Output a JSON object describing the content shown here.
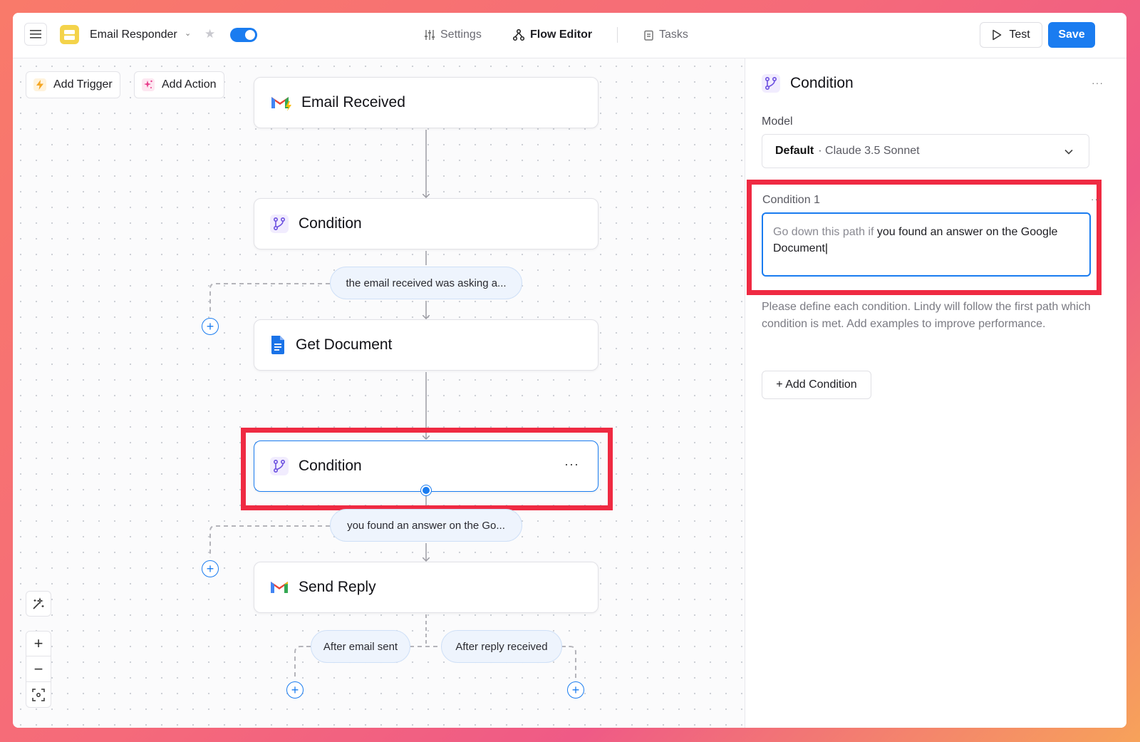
{
  "header": {
    "app_name": "Email Responder",
    "nav": {
      "settings": "Settings",
      "flow_editor": "Flow Editor",
      "tasks": "Tasks"
    },
    "test_label": "Test",
    "save_label": "Save",
    "accent": "#1a7cf0"
  },
  "toolbar": {
    "add_trigger": "Add Trigger",
    "add_action": "Add Action"
  },
  "flow": {
    "nodes": [
      {
        "title": "Email Received",
        "icon": "gmail-icon"
      },
      {
        "title": "Condition",
        "icon": "branch-icon"
      },
      {
        "title": "Get Document",
        "icon": "google-doc-icon"
      },
      {
        "title": "Condition",
        "icon": "branch-icon",
        "more": "···"
      },
      {
        "title": "Send Reply",
        "icon": "gmail-icon"
      }
    ],
    "edges": {
      "cond1_path": "the email received was asking a...",
      "cond2_path": "you found an answer on the Go...",
      "after_sent": "After email sent",
      "after_reply": "After reply received"
    }
  },
  "panel": {
    "title": "Condition",
    "more": "···",
    "model_label": "Model",
    "model_value_bold": "Default",
    "model_value": "· Claude 3.5 Sonnet",
    "condition_label": "Condition 1",
    "condition_more": "···",
    "condition_prefix": "Go down this path if",
    "condition_text": "you found an answer on the Google Document",
    "help_text": "Please define each condition. Lindy will follow the first path which condition is met. Add examples to improve performance.",
    "add_condition": "+ Add Condition"
  }
}
